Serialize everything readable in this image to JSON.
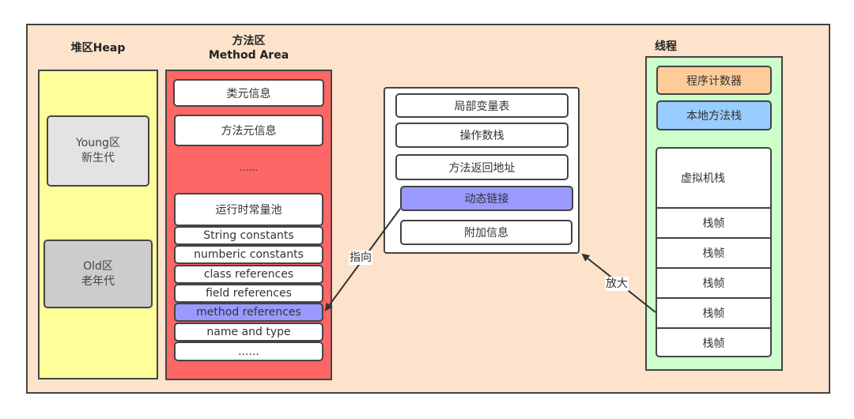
{
  "heap": {
    "title": "堆区Heap",
    "young": {
      "line1": "Young区",
      "line2": "新生代"
    },
    "old": {
      "line1": "Old区",
      "line2": "老年代"
    }
  },
  "method_area": {
    "title_line1": "方法区",
    "title_line2": "Method Area",
    "class_info": "类元信息",
    "method_info": "方法元信息",
    "ellipsis": "......",
    "constant_pool": {
      "title": "运行时常量池",
      "items": [
        "String constants",
        "numberic constants",
        "class references",
        "field references",
        "method references",
        "name and type",
        "......"
      ]
    }
  },
  "stack_frame": {
    "items": [
      "局部变量表",
      "操作数栈",
      "方法返回地址",
      "动态链接",
      "附加信息"
    ]
  },
  "thread": {
    "title": "线程",
    "pc_register": "程序计数器",
    "native_stack": "本地方法栈",
    "vm_stack": {
      "title": "虚拟机栈",
      "frames": [
        "栈帧",
        "栈帧",
        "栈帧",
        "栈帧",
        "栈帧"
      ]
    }
  },
  "arrows": {
    "points_to": "指向",
    "zoom_in": "放大"
  },
  "colors": {
    "background": "#fde3cb",
    "heap": "#ffff99",
    "method_area": "#ff6666",
    "highlight": "#9999ff",
    "thread": "#ccffcc",
    "pc_register": "#ffcc99",
    "native_stack": "#99ccff"
  }
}
